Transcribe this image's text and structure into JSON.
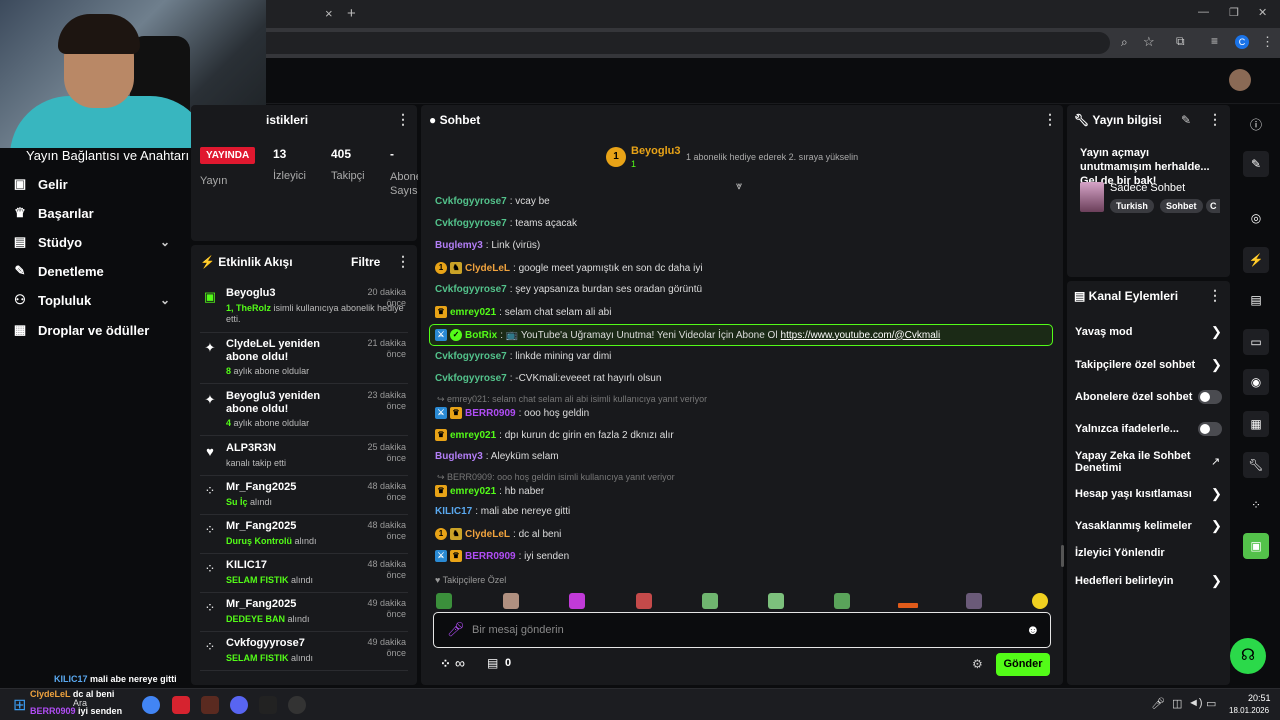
{
  "browser": {
    "new_tab": "+",
    "close_tab": "×",
    "window_min": "—",
    "window_max": "❐",
    "window_close": "✕"
  },
  "nav": {
    "title": "Yayın Bağlantısı ve Anahtarı",
    "items": [
      {
        "label": "Gelir",
        "icon": "wallet-icon"
      },
      {
        "label": "Başarılar",
        "icon": "trophy-icon"
      },
      {
        "label": "Stüdyo",
        "icon": "studio-icon",
        "chevron": "⌄"
      },
      {
        "label": "Denetleme",
        "icon": "wrench-icon"
      },
      {
        "label": "Topluluk",
        "icon": "community-icon",
        "chevron": "⌄"
      },
      {
        "label": "Droplar ve ödüller",
        "icon": "drops-icon"
      }
    ]
  },
  "stats": {
    "title": "istikleri",
    "live_badge": "YAYINDA",
    "live_label": "Yayın",
    "viewers": "13",
    "viewers_label": "İzleyici",
    "followers": "405",
    "followers_label": "Takipçi",
    "subs": "-",
    "subs_label": "Abone Sayısı"
  },
  "activity": {
    "title": "Etkinlik Akışı",
    "filter": "Filtre",
    "items": [
      {
        "name": "Beyoglu3",
        "time": "20 dakika önce",
        "num": "1",
        "desc_user": "TheRolz",
        "desc": " isimli kullanıcıya abonelik hediye etti."
      },
      {
        "name": "ClydeLeL yeniden abone oldu!",
        "time": "21 dakika önce",
        "num": "8",
        "desc": " aylık abone oldular"
      },
      {
        "name": "Beyoglu3 yeniden abone oldu!",
        "time": "23 dakika önce",
        "num": "4",
        "desc": " aylık abone oldular"
      },
      {
        "name": "ALP3R3N",
        "time": "25 dakika önce",
        "desc": "kanalı takip etti"
      },
      {
        "name": "Mr_Fang2025",
        "time": "48 dakika önce",
        "reward": "Su İç",
        "desc": " alındı"
      },
      {
        "name": "Mr_Fang2025",
        "time": "48 dakika önce",
        "reward": "Duruş Kontrolü",
        "desc": " alındı"
      },
      {
        "name": "KILIC17",
        "time": "48 dakika önce",
        "reward": "SELAM FISTIK",
        "desc": " alındı"
      },
      {
        "name": "Mr_Fang2025",
        "time": "49 dakika önce",
        "reward": "DEDEYE BAN",
        "desc": " alındı"
      },
      {
        "name": "Cvkfogyyrose7",
        "time": "49 dakika önce",
        "reward": "SELAM FISTIK",
        "desc": " alındı"
      }
    ]
  },
  "chat": {
    "title": "Sohbet",
    "top_gifter": "Beyoglu3",
    "top_gifter_count": "1",
    "top_gifter_rank": "1",
    "gift_hint": "1 abonelik hediye ederek 2. sıraya yükselin",
    "messages": [
      {
        "user": "Cvkfogyyrose7",
        "color": "#53c28b",
        "text": ": vcay be"
      },
      {
        "user": "Cvkfogyyrose7",
        "color": "#53c28b",
        "text": ": teams açacak"
      },
      {
        "user": "Buglemy3",
        "color": "#b37ef7",
        "text": ": Link (virüs)"
      },
      {
        "user": "ClydeLeL",
        "color": "#f0a33e",
        "text": ": google meet yapmıştık en son dc daha iyi"
      },
      {
        "user": "Cvkfogyyrose7",
        "color": "#53c28b",
        "text": ": şey yapsanıza burdan ses oradan görüntü"
      },
      {
        "user": "emrey021",
        "color": "#53fc18",
        "text": ": selam chat selam ali abi"
      },
      {
        "user": "BotRix",
        "color": "#53fc18",
        "text": ": 📺 YouTube'a Uğramayı Unutma! Yeni Videolar İçin Abone Ol ",
        "link": "https://www.youtube.com/@Cvkmali"
      },
      {
        "user": "Cvkfogyyrose7",
        "color": "#53c28b",
        "text": ": linkde mining var dimi"
      },
      {
        "user": "Cvkfogyyrose7",
        "color": "#53c28b",
        "text": ": -CVKmali:eveeet rat hayırlı olsun"
      },
      {
        "reply": "↪ emrey021: selam chat selam ali abi isimli kullanıcıya yanıt veriyor"
      },
      {
        "user": "BERR0909",
        "color": "#b04df5",
        "text": ": ooo hoş geldin"
      },
      {
        "user": "emrey021",
        "color": "#53fc18",
        "text": ": dpı kurun dc girin en fazla 2 dknızı alır"
      },
      {
        "user": "Buglemy3",
        "color": "#b37ef7",
        "text": ": Aleyküm selam"
      },
      {
        "reply": "↪ BERR0909: ooo hoş geldin isimli kullanıcıya yanıt veriyor"
      },
      {
        "user": "emrey021",
        "color": "#53fc18",
        "text": ": hb naber"
      },
      {
        "user": "KILIC17",
        "color": "#5aa9f0",
        "text": ": mali abe nereye gitti"
      },
      {
        "user": "ClydeLeL",
        "color": "#f0a33e",
        "text": ": dc al beni"
      },
      {
        "user": "BERR0909",
        "color": "#b04df5",
        "text": ": iyi senden"
      }
    ],
    "followers_only": "♥ Takipçilere Özel",
    "input_placeholder": "Bir mesaj gönderin",
    "points": "∞",
    "store_count": "0",
    "send": "Gönder"
  },
  "stream_info": {
    "title": "Yayın bilgisi",
    "text": "Yayın açmayı unutmamışım herhalde... Gel de bir bak!",
    "category": "Sadece Sohbet",
    "tags": [
      "Turkish",
      "Sohbet",
      "C"
    ]
  },
  "channel_actions": {
    "title": "Kanal Eylemleri",
    "items": [
      {
        "label": "Yavaş mod",
        "type": "chevron"
      },
      {
        "label": "Takipçilere özel sohbet",
        "type": "chevron"
      },
      {
        "label": "Abonelere özel sohbet",
        "type": "toggle"
      },
      {
        "label": "Yalnızca ifadelerle...",
        "type": "toggle"
      },
      {
        "label": "Yapay Zeka ile Sohbet Denetimi",
        "type": "external"
      },
      {
        "label": "Hesap yaşı kısıtlaması",
        "type": "chevron"
      },
      {
        "label": "Yasaklanmış kelimeler",
        "type": "chevron"
      },
      {
        "label": "İzleyici Yönlendir",
        "type": "none"
      },
      {
        "label": "Hedefleri belirleyin",
        "type": "chevron"
      }
    ]
  },
  "overlay_chat": [
    {
      "user": "KILIC17",
      "text": "mali abe nereye gitti"
    },
    {
      "user": "ClydeLeL",
      "text": "dc al beni"
    },
    {
      "user": "BERR0909",
      "text": "iyi senden"
    }
  ],
  "taskbar": {
    "search": "Ara",
    "time": "20:51",
    "date": "18.01.2026"
  }
}
